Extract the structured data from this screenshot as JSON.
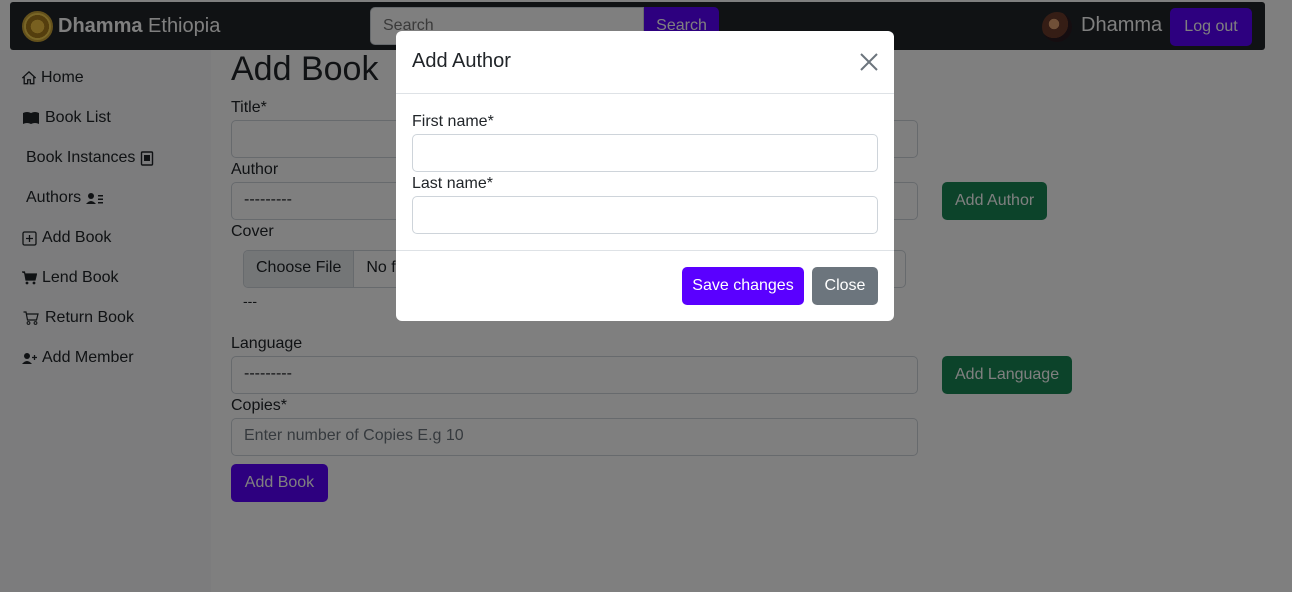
{
  "navbar": {
    "brand_bold": "Dhamma",
    "brand_rest": " Ethiopia",
    "search_placeholder": "Search",
    "search_button": "Search",
    "username": "Dhamma",
    "logout": "Log out"
  },
  "sidebar": {
    "items": [
      {
        "label": "Home",
        "icon": "house-icon"
      },
      {
        "label": "Book List",
        "icon": "book-icon"
      },
      {
        "label": "Book Instances",
        "icon": "journal-icon"
      },
      {
        "label": "Authors",
        "icon": "person-lines-icon"
      },
      {
        "label": "Add Book",
        "icon": "plus-square-icon"
      },
      {
        "label": "Lend Book",
        "icon": "cart-fill-icon"
      },
      {
        "label": "Return Book",
        "icon": "cart-icon"
      },
      {
        "label": "Add Member",
        "icon": "person-plus-icon"
      }
    ]
  },
  "form": {
    "title": "Add Book",
    "title_label": "Title*",
    "author_label": "Author",
    "author_value": "---------",
    "add_author": "Add Author",
    "cover_label": "Cover",
    "choose_file": "Choose File",
    "no_file": "No f",
    "cover_dashes": "---",
    "language_label": "Language",
    "language_value": "---------",
    "add_language": "Add Language",
    "copies_label": "Copies*",
    "copies_placeholder": "Enter number of Copies E.g 10",
    "submit": "Add Book"
  },
  "modal": {
    "title": "Add Author",
    "first_name_label": "First name*",
    "last_name_label": "Last name*",
    "save": "Save changes",
    "close": "Close"
  }
}
